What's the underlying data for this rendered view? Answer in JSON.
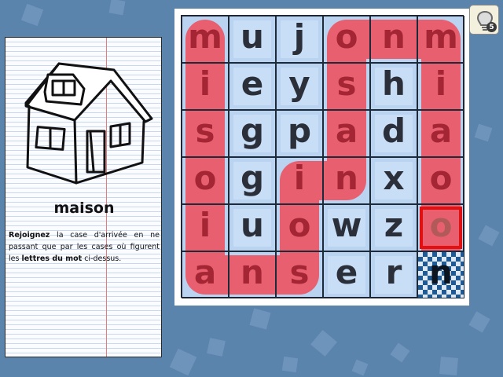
{
  "word_card": {
    "picture": "house-drawing",
    "word": "maison",
    "instruction_parts": [
      {
        "text": "Rejoignez",
        "bold": true
      },
      {
        "text": " la case d'arrivée en ne passant que par les cases où figurent les ",
        "bold": false
      },
      {
        "text": "lettres du mot",
        "bold": true
      },
      {
        "text": " ci-dessus.",
        "bold": false
      }
    ]
  },
  "board": {
    "rows": [
      [
        "m",
        "u",
        "j",
        "o",
        "n",
        "m"
      ],
      [
        "i",
        "e",
        "y",
        "s",
        "h",
        "i"
      ],
      [
        "s",
        "g",
        "p",
        "a",
        "d",
        "a"
      ],
      [
        "o",
        "g",
        "i",
        "n",
        "x",
        "o"
      ],
      [
        "i",
        "u",
        "o",
        "w",
        "z",
        "o"
      ],
      [
        "a",
        "n",
        "s",
        "e",
        "r",
        "n"
      ]
    ],
    "path": [
      [
        5,
        5
      ],
      [
        4,
        5
      ],
      [
        3,
        5
      ],
      [
        2,
        5
      ],
      [
        1,
        5
      ],
      [
        0,
        5
      ],
      [
        0,
        4
      ],
      [
        0,
        3
      ],
      [
        1,
        3
      ],
      [
        2,
        3
      ],
      [
        3,
        3
      ],
      [
        3,
        2
      ],
      [
        4,
        2
      ],
      [
        5,
        2
      ],
      [
        5,
        1
      ],
      [
        5,
        0
      ],
      [
        4,
        0
      ],
      [
        3,
        0
      ],
      [
        2,
        0
      ],
      [
        1,
        0
      ],
      [
        0,
        0
      ]
    ],
    "current_cell": [
      4,
      5
    ],
    "finish_cell": [
      5,
      5
    ],
    "colors": {
      "path": "#e8606f",
      "cursor": "#e21010",
      "finish": "#1e5a96"
    }
  },
  "hint_button": {
    "icon": "lightbulb-icon",
    "count": "5"
  }
}
